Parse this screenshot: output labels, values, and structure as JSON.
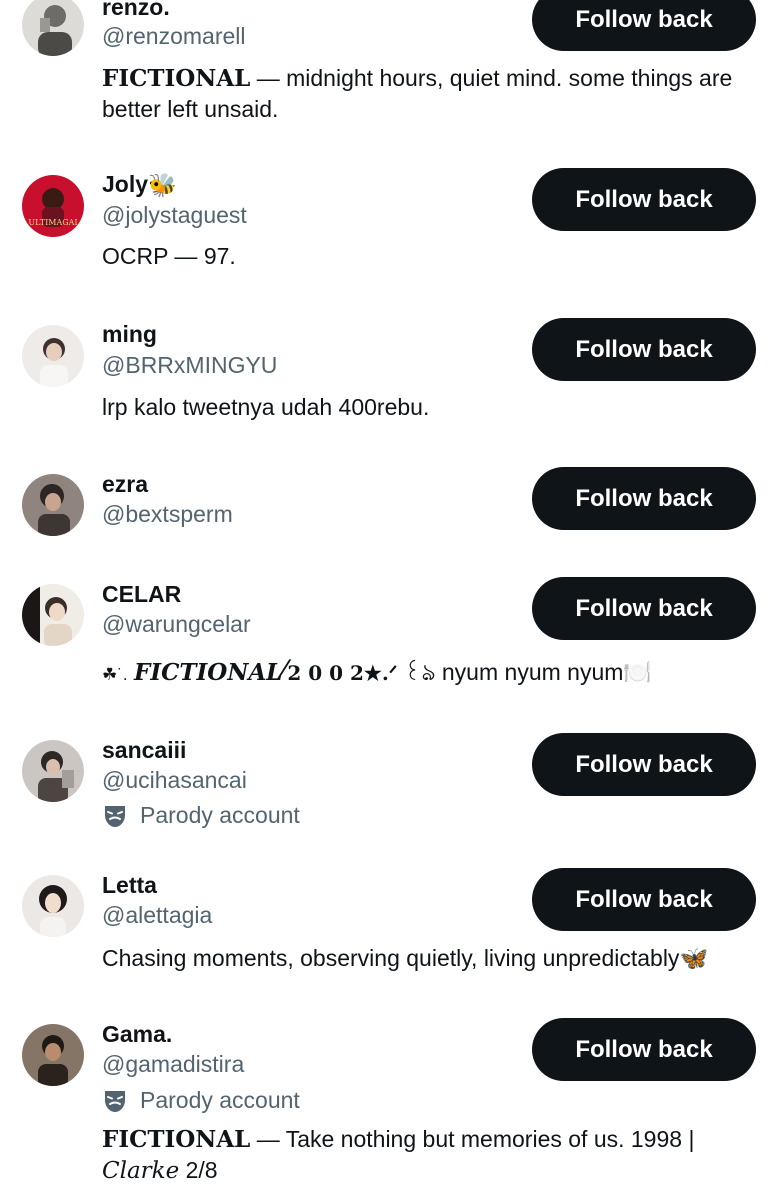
{
  "accounts": [
    {
      "name": "renzo.",
      "handle": "@renzomarell",
      "bio_prefix": "FICTIONAL",
      "bio_text": " — midnight hours, quiet mind. some things are better left unsaid.",
      "button": "Follow back",
      "avatar_colors": [
        "#d9d9d6",
        "#7d7c78"
      ]
    },
    {
      "name": "Joly",
      "name_emoji": "🐝",
      "handle": "@jolystaguest",
      "bio_text": "OCRP — 97.",
      "button": "Follow back",
      "avatar_caption": "ULTIMAGAI",
      "avatar_colors": [
        "#c8102e",
        "#5a0710"
      ]
    },
    {
      "name": "ming",
      "handle": "@BRRxMINGYU",
      "bio_text": "lrp kalo tweetnya udah 400rebu.",
      "button": "Follow back",
      "avatar_colors": [
        "#ece9e6",
        "#b7b2ad"
      ]
    },
    {
      "name": "ezra",
      "handle": "@bextsperm",
      "button": "Follow back",
      "avatar_colors": [
        "#9c8f87",
        "#3d3633"
      ]
    },
    {
      "name": "CELAR",
      "handle": "@warungcelar",
      "bio_lead": "☘˙.",
      "bio_styled": "FICTIONAL",
      "bio_slash": "∕",
      "bio_year": "2 0 0 2★.ᐟ",
      "bio_text": " ꒰ঌ nyum nyum nyum",
      "bio_emoji": "🍽️",
      "button": "Follow back",
      "avatar_colors": [
        "#f2efea",
        "#c9b9a8"
      ]
    },
    {
      "name": "sancaiii",
      "handle": "@ucihasancai",
      "parody_label": "Parody account",
      "button": "Follow back",
      "avatar_colors": [
        "#cfcac6",
        "#57504c"
      ]
    },
    {
      "name": "Letta",
      "handle": "@alettagia",
      "bio_text": "Chasing moments, observing quietly, living unpredictably",
      "bio_emoji": "🦋",
      "button": "Follow back",
      "avatar_colors": [
        "#e8e6e3",
        "#2b2624"
      ]
    },
    {
      "name": "Gama.",
      "handle": "@gamadistira",
      "parody_label": "Parody account",
      "bio_prefix": "FICTIONAL",
      "bio_text": " — Take nothing but memories of us. 1998 |",
      "bio_italic": "Clarke",
      "bio_tail": " 2/8",
      "button": "Follow back",
      "avatar_colors": [
        "#8a7a6b",
        "#2a221c"
      ]
    }
  ]
}
